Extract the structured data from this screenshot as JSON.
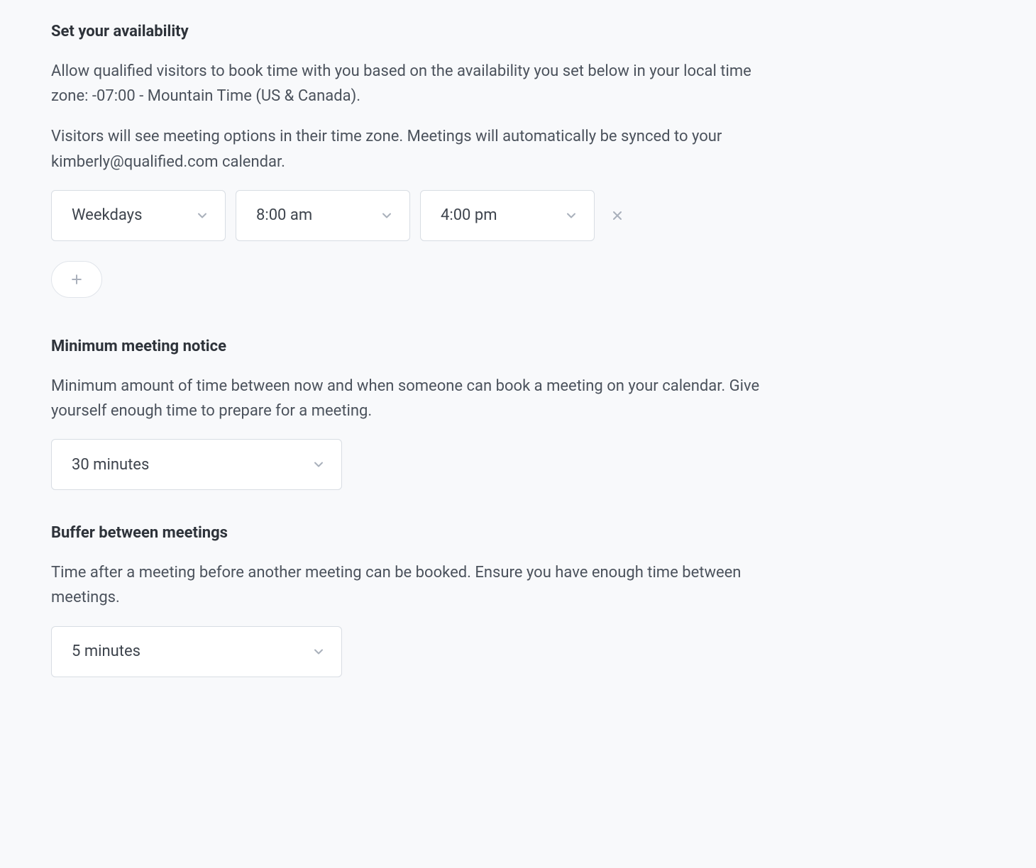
{
  "availability": {
    "title": "Set your availability",
    "desc1": "Allow qualified visitors to book time with you based on the availability you set below in your local time zone: -07:00 - Mountain Time (US & Canada).",
    "desc2": "Visitors will see meeting options in their time zone. Meetings will automatically be synced to your kimberly@qualified.com calendar.",
    "row": {
      "days": "Weekdays",
      "start": "8:00 am",
      "end": "4:00 pm"
    }
  },
  "notice": {
    "title": "Minimum meeting notice",
    "desc": "Minimum amount of time between now and when someone can book a meeting on your calendar. Give yourself enough time to prepare for a meeting.",
    "value": "30 minutes"
  },
  "buffer": {
    "title": "Buffer between meetings",
    "desc": "Time after a meeting before another meeting can be booked. Ensure you have enough time between meetings.",
    "value": "5 minutes"
  }
}
